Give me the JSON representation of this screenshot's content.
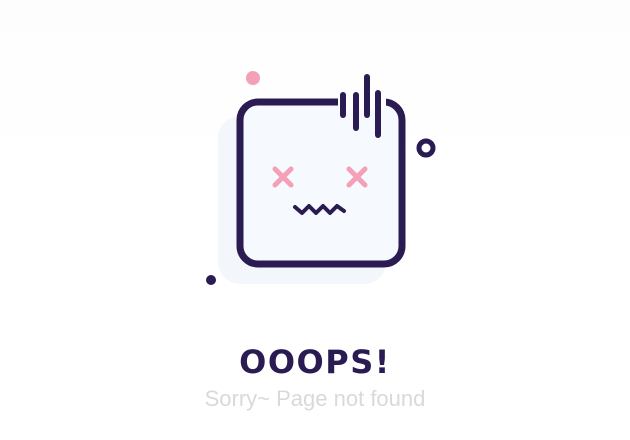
{
  "illustration": {
    "icon": "broken-face-icon",
    "outline_color": "#2a1b52",
    "accent_color": "#f4a0b7",
    "shadow_color": "#f3f7fc"
  },
  "message": {
    "title": "OOOPS!",
    "subtitle": "Sorry~ Page not found"
  }
}
